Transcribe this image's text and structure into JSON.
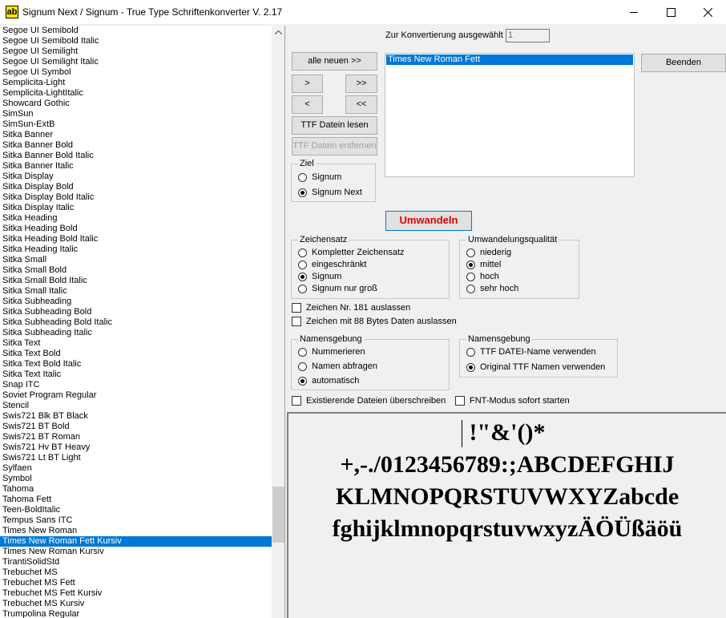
{
  "window": {
    "icon_text": "ab",
    "title": "Signum Next / Signum - True Type Schriftenkonverter V. 2.17"
  },
  "fontlist": {
    "items": [
      "Segoe UI Semibold",
      "Segoe UI Semibold Italic",
      "Segoe UI Semilight",
      "Segoe UI Semilight Italic",
      "Segoe UI Symbol",
      "Semplicita-Light",
      "Semplicita-LightItalic",
      "Showcard Gothic",
      "SimSun",
      "SimSun-ExtB",
      "Sitka Banner",
      "Sitka Banner Bold",
      "Sitka Banner Bold Italic",
      "Sitka Banner Italic",
      "Sitka Display",
      "Sitka Display Bold",
      "Sitka Display Bold Italic",
      "Sitka Display Italic",
      "Sitka Heading",
      "Sitka Heading Bold",
      "Sitka Heading Bold Italic",
      "Sitka Heading Italic",
      "Sitka Small",
      "Sitka Small Bold",
      "Sitka Small Bold Italic",
      "Sitka Small Italic",
      "Sitka Subheading",
      "Sitka Subheading Bold",
      "Sitka Subheading Bold Italic",
      "Sitka Subheading Italic",
      "Sitka Text",
      "Sitka Text Bold",
      "Sitka Text Bold Italic",
      "Sitka Text Italic",
      "Snap ITC",
      "Soviet Program Regular",
      "Stencil",
      "Swis721 Blk BT Black",
      "Swis721 BT Bold",
      "Swis721 BT Roman",
      "Swis721 Hv BT Heavy",
      "Swis721 Lt BT Light",
      "Sylfaen",
      "Symbol",
      "Tahoma",
      "Tahoma Fett",
      "Teen-BoldItalic",
      "Tempus Sans ITC",
      "Times New Roman",
      "Times New Roman Fett Kursiv",
      "Times New Roman Kursiv",
      "TirantiSolidStd",
      "Trebuchet MS",
      "Trebuchet MS Fett",
      "Trebuchet MS Fett Kursiv",
      "Trebuchet MS Kursiv",
      "Trumpolina Regular"
    ],
    "selected": "Times New Roman Fett Kursiv"
  },
  "conversion": {
    "count_label": "Zur Konvertierung ausgewählt",
    "count_value": "1",
    "selected_items": [
      "Times New Roman Fett"
    ]
  },
  "buttons": {
    "all_new": "alle neuen >>",
    "add": ">",
    "add_all": ">>",
    "remove": "<",
    "remove_all": "<<",
    "read_ttf": "TTF Datein lesen",
    "remove_ttf": "TTF Datein entfernen",
    "quit": "Beenden",
    "convert": "Umwandeln"
  },
  "ziel": {
    "title": "Ziel",
    "options": [
      "Signum",
      "Signum Next"
    ],
    "selected": "Signum Next"
  },
  "zeichensatz": {
    "title": "Zeichensatz",
    "options": [
      "Kompletter Zeichensatz",
      "eingeschränkt",
      "Signum",
      "Signum nur groß"
    ],
    "selected": "Signum"
  },
  "qualitaet": {
    "title": "Umwandelungsqualität",
    "options": [
      "niederig",
      "mittel",
      "hoch",
      "sehr hoch"
    ],
    "selected": "mittel"
  },
  "checkboxes": {
    "char181": "Zeichen Nr. 181 auslassen",
    "char88": "Zeichen mit 88 Bytes Daten auslassen",
    "overwrite": "Existierende Dateien überschreiben",
    "fnt_mode": "FNT-Modus sofort starten"
  },
  "namensgebung1": {
    "title": "Namensgebung",
    "options": [
      "Nummerieren",
      "Namen abfragen",
      "automatisch"
    ],
    "selected": "automatisch"
  },
  "namensgebung2": {
    "title": "Namensgebung",
    "options": [
      "TTF DATEI-Name verwenden",
      "Original TTF Namen verwenden"
    ],
    "selected": "Original TTF Namen verwenden"
  },
  "preview": {
    "lines": [
      "!\"&'()*",
      "+,-./0123456789:;ABCDEFGHIJ",
      "KLMNOPQRSTUVWXYZabcde",
      "fghijklmnopqrstuvwxyzÄÖÜßäöü"
    ]
  }
}
